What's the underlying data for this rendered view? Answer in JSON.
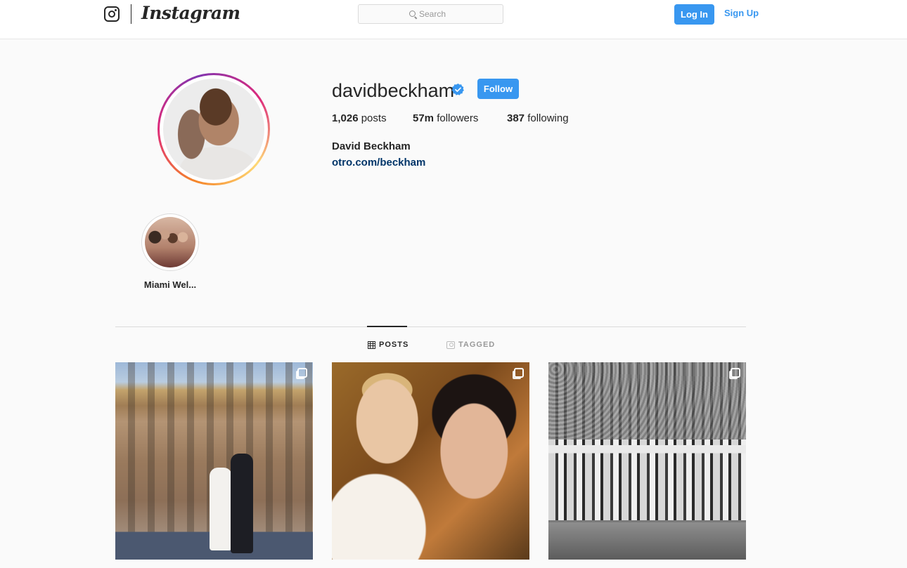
{
  "nav": {
    "logo_icon": "instagram-camera-icon",
    "wordmark": "Instagram",
    "search_placeholder": "Search",
    "login_label": "Log In",
    "signup_label": "Sign Up",
    "accent_color": "#3897f0"
  },
  "profile": {
    "username": "davidbeckham",
    "verified_icon": "verified-badge-icon",
    "follow_label": "Follow",
    "stats": {
      "posts_count": "1,026",
      "posts_label": "posts",
      "followers_count": "57m",
      "followers_label": "followers",
      "following_count": "387",
      "following_label": "following"
    },
    "full_name": "David Beckham",
    "website": "otro.com/beckham"
  },
  "highlights": [
    {
      "label": "Miami Wel..."
    }
  ],
  "tabs": [
    {
      "label": "POSTS",
      "icon": "grid-icon",
      "active": true
    },
    {
      "label": "TAGGED",
      "icon": "tagged-icon",
      "active": false
    }
  ],
  "posts": [
    {
      "icon": "multiple-photos-icon"
    },
    {
      "icon": "multiple-photos-icon"
    },
    {
      "icon": "multiple-photos-icon"
    }
  ]
}
